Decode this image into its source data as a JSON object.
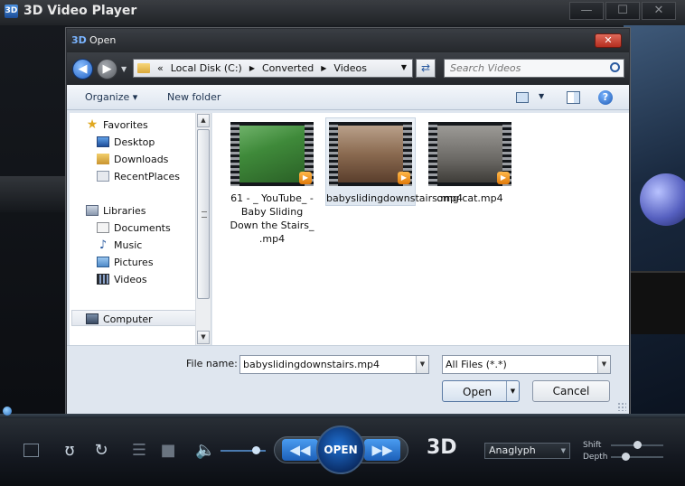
{
  "player": {
    "logo": "3D",
    "title": "3D Video Player",
    "window_buttons": [
      "—",
      "☐",
      "✕"
    ]
  },
  "dialog": {
    "logo": "3D",
    "title": "Open",
    "close_glyph": "✕",
    "address": {
      "prefix": "«",
      "crumbs": [
        "Local Disk (C:)",
        "Converted",
        "Videos"
      ]
    },
    "search_placeholder": "Search Videos",
    "toolbar": {
      "organize": "Organize ▾",
      "new_folder": "New folder",
      "help": "?"
    },
    "nav": {
      "favorites": "Favorites",
      "favorites_items": [
        "Desktop",
        "Downloads",
        "RecentPlaces"
      ],
      "libraries": "Libraries",
      "libraries_items": [
        "Documents",
        "Music",
        "Pictures",
        "Videos"
      ],
      "computer": "Computer"
    },
    "files": [
      {
        "name": "61 - _    YouTube_ - Baby Sliding Down the Stairs_ .mp4"
      },
      {
        "name": "babyslidingdownstairs.mp4"
      },
      {
        "name": "omg cat.mp4"
      }
    ],
    "file_name_label": "File name:",
    "file_name_value": "babyslidingdownstairs.mp4",
    "file_type_value": "All Files (*.*)",
    "open_label": "Open",
    "cancel_label": "Cancel"
  },
  "controls": {
    "open_label": "OPEN",
    "three_d_label": "3D",
    "mode_value": "Anaglyph",
    "shift_label": "Shift",
    "depth_label": "Depth",
    "shift_value": 0.5,
    "depth_value": 0.25,
    "volume_value": 0.85
  }
}
